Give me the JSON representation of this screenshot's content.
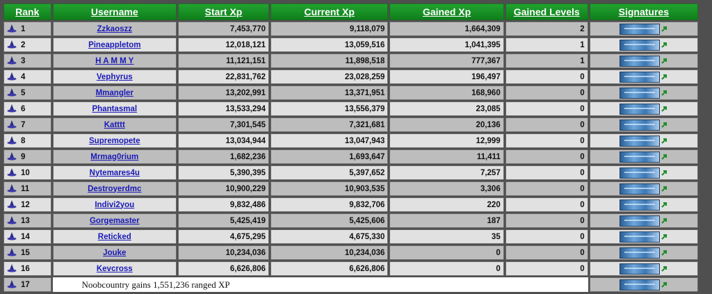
{
  "headers": {
    "rank": "Rank",
    "username": "Username",
    "start_xp": "Start Xp",
    "current_xp": "Current Xp",
    "gained_xp": "Gained Xp",
    "gained_levels": "Gained Levels",
    "signatures": "Signatures"
  },
  "rows": [
    {
      "rank": "1",
      "username": "Zzkaoszz",
      "start_xp": "7,453,770",
      "current_xp": "9,118,079",
      "gained_xp": "1,664,309",
      "gained_levels": "2"
    },
    {
      "rank": "2",
      "username": "Pineappletom",
      "start_xp": "12,018,121",
      "current_xp": "13,059,516",
      "gained_xp": "1,041,395",
      "gained_levels": "1"
    },
    {
      "rank": "3",
      "username": "H A M M Y",
      "start_xp": "11,121,151",
      "current_xp": "11,898,518",
      "gained_xp": "777,367",
      "gained_levels": "1"
    },
    {
      "rank": "4",
      "username": "Vephyrus",
      "start_xp": "22,831,762",
      "current_xp": "23,028,259",
      "gained_xp": "196,497",
      "gained_levels": "0"
    },
    {
      "rank": "5",
      "username": "Mmangler",
      "start_xp": "13,202,991",
      "current_xp": "13,371,951",
      "gained_xp": "168,960",
      "gained_levels": "0"
    },
    {
      "rank": "6",
      "username": "Phantasmal",
      "start_xp": "13,533,294",
      "current_xp": "13,556,379",
      "gained_xp": "23,085",
      "gained_levels": "0"
    },
    {
      "rank": "7",
      "username": "Katttt",
      "start_xp": "7,301,545",
      "current_xp": "7,321,681",
      "gained_xp": "20,136",
      "gained_levels": "0"
    },
    {
      "rank": "8",
      "username": "Supremopete",
      "start_xp": "13,034,944",
      "current_xp": "13,047,943",
      "gained_xp": "12,999",
      "gained_levels": "0"
    },
    {
      "rank": "9",
      "username": "Mrmag0rium",
      "start_xp": "1,682,236",
      "current_xp": "1,693,647",
      "gained_xp": "11,411",
      "gained_levels": "0"
    },
    {
      "rank": "10",
      "username": "Nytemares4u",
      "start_xp": "5,390,395",
      "current_xp": "5,397,652",
      "gained_xp": "7,257",
      "gained_levels": "0"
    },
    {
      "rank": "11",
      "username": "Destroyerdmc",
      "start_xp": "10,900,229",
      "current_xp": "10,903,535",
      "gained_xp": "3,306",
      "gained_levels": "0"
    },
    {
      "rank": "12",
      "username": "Indivi2you",
      "start_xp": "9,832,486",
      "current_xp": "9,832,706",
      "gained_xp": "220",
      "gained_levels": "0"
    },
    {
      "rank": "13",
      "username": "Gorgemaster",
      "start_xp": "5,425,419",
      "current_xp": "5,425,606",
      "gained_xp": "187",
      "gained_levels": "0"
    },
    {
      "rank": "14",
      "username": "Reticked",
      "start_xp": "4,675,295",
      "current_xp": "4,675,330",
      "gained_xp": "35",
      "gained_levels": "0"
    },
    {
      "rank": "15",
      "username": "Jouke",
      "start_xp": "10,234,036",
      "current_xp": "10,234,036",
      "gained_xp": "0",
      "gained_levels": "0"
    },
    {
      "rank": "16",
      "username": "Kevcross",
      "start_xp": "6,626,806",
      "current_xp": "6,626,806",
      "gained_xp": "0",
      "gained_levels": "0"
    }
  ],
  "last_row": {
    "rank": "17",
    "notice": "Noobcountry gains 1,551,236 ranged XP"
  },
  "icons": {
    "rank_icon": "wizard-hat-icon",
    "signature_icon": "signature-banner-icon",
    "external_icon": "external-link-icon"
  },
  "colors": {
    "header_green": "#169127",
    "row_dark": "#bdbdbd",
    "row_light": "#e1e1e1",
    "link_blue": "#1a1ab8"
  }
}
